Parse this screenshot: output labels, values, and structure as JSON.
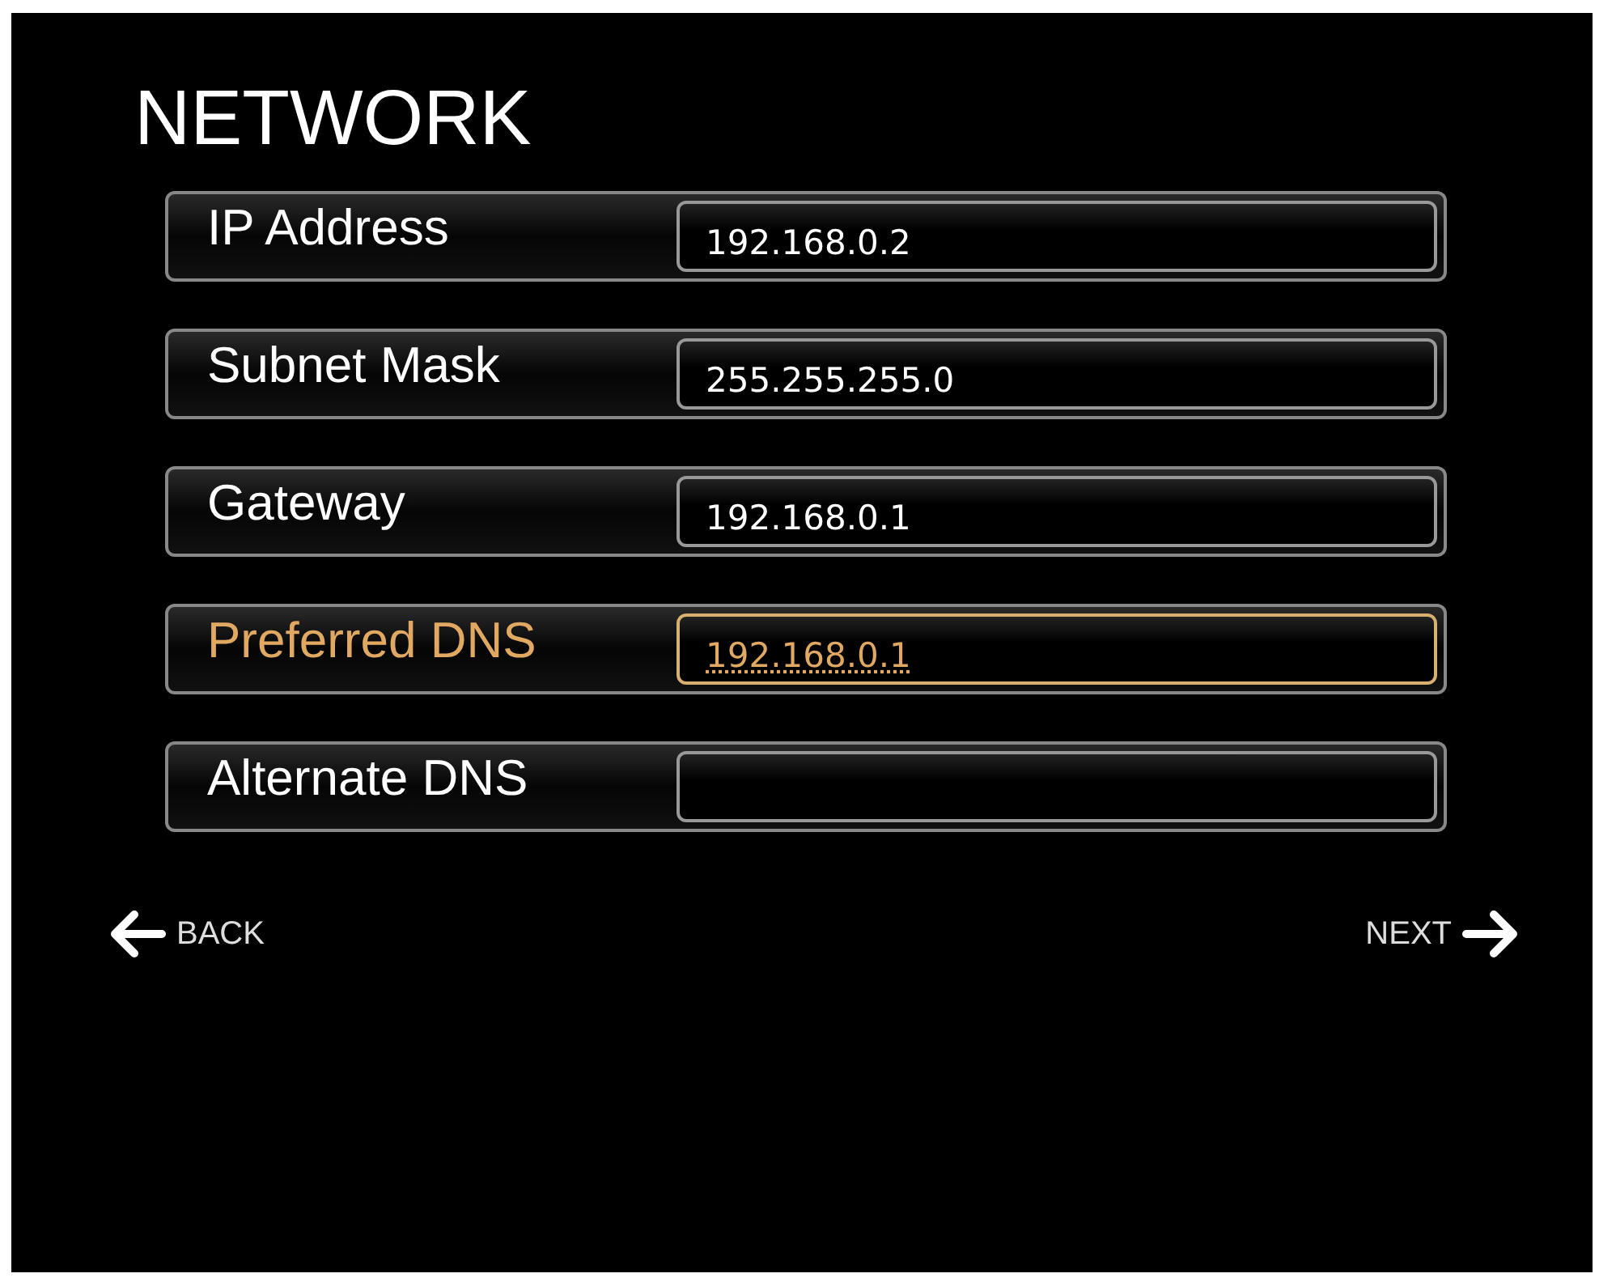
{
  "title": "NETWORK",
  "fields": [
    {
      "label": "IP Address",
      "value": "192.168.0.2",
      "selected": false
    },
    {
      "label": "Subnet Mask",
      "value": "255.255.255.0",
      "selected": false
    },
    {
      "label": "Gateway",
      "value": "192.168.0.1",
      "selected": false
    },
    {
      "label": "Preferred DNS",
      "value": "192.168.0.1",
      "selected": true
    },
    {
      "label": "Alternate DNS",
      "selected": false
    }
  ],
  "nav": {
    "back": "BACK",
    "next": "NEXT"
  }
}
